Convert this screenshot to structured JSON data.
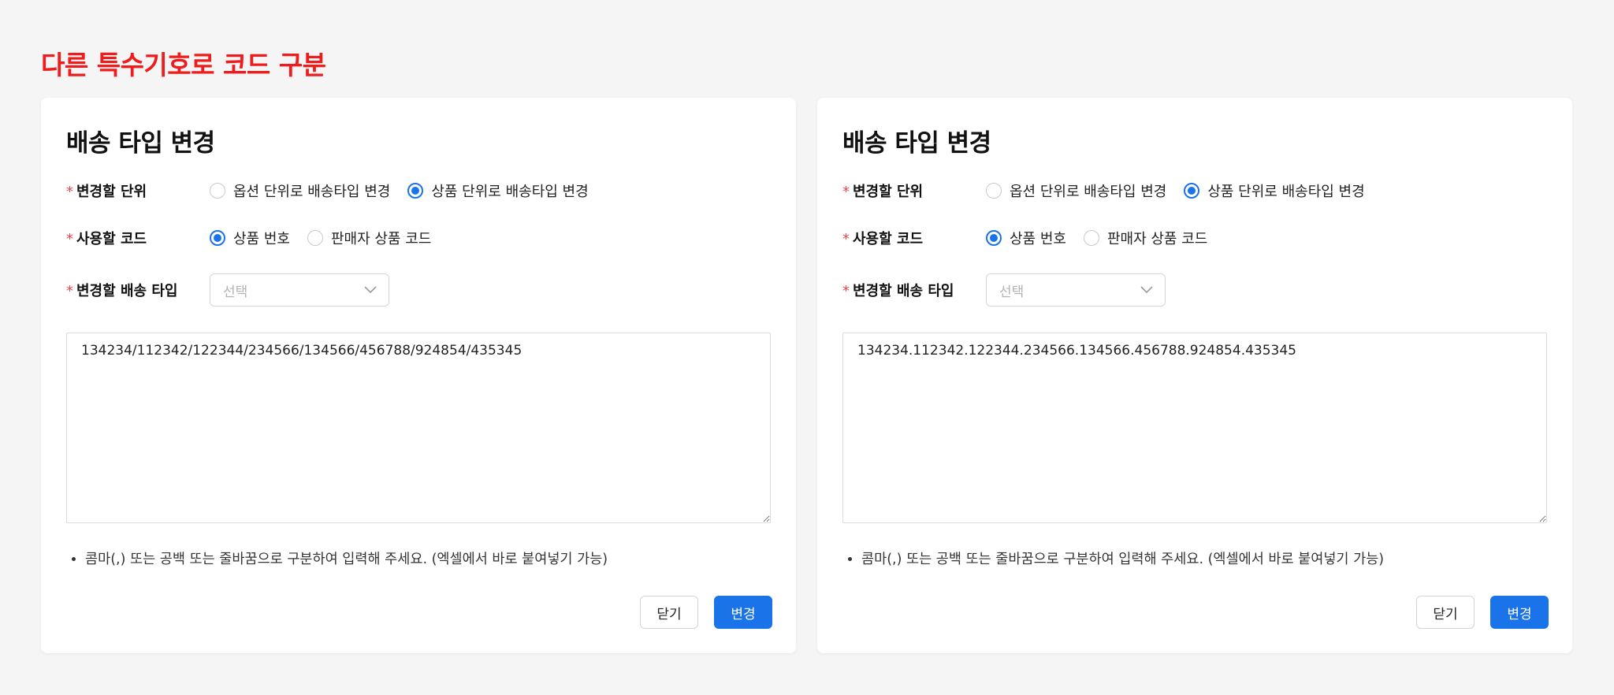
{
  "page": {
    "heading": "다른 특수기호로 코드 구분",
    "heading_color": "#ee1c1c",
    "accent_color": "#1a73e8"
  },
  "modals": [
    {
      "title": "배송 타입 변경",
      "required_mark": "*",
      "unit_label": "변경할 단위",
      "unit_options": [
        {
          "label": "옵션 단위로 배송타입 변경",
          "checked": false
        },
        {
          "label": "상품 단위로 배송타입 변경",
          "checked": true
        }
      ],
      "code_label": "사용할 코드",
      "code_options": [
        {
          "label": "상품 번호",
          "checked": true
        },
        {
          "label": "판매자 상품 코드",
          "checked": false
        }
      ],
      "type_label": "변경할 배송 타입",
      "type_select_placeholder": "선택",
      "chevron_icon": "chevron-down-icon",
      "codes_value": "134234/112342/122344/234566/134566/456788/924854/435345",
      "help_text": "콤마(,) 또는 공백 또는 줄바꿈으로 구분하여 입력해 주세요. (엑셀에서 바로 붙여넣기 가능)",
      "close_label": "닫기",
      "submit_label": "변경"
    },
    {
      "title": "배송 타입 변경",
      "required_mark": "*",
      "unit_label": "변경할 단위",
      "unit_options": [
        {
          "label": "옵션 단위로 배송타입 변경",
          "checked": false
        },
        {
          "label": "상품 단위로 배송타입 변경",
          "checked": true
        }
      ],
      "code_label": "사용할 코드",
      "code_options": [
        {
          "label": "상품 번호",
          "checked": true
        },
        {
          "label": "판매자 상품 코드",
          "checked": false
        }
      ],
      "type_label": "변경할 배송 타입",
      "type_select_placeholder": "선택",
      "chevron_icon": "chevron-down-icon",
      "codes_value": "134234.112342.122344.234566.134566.456788.924854.435345",
      "help_text": "콤마(,) 또는 공백 또는 줄바꿈으로 구분하여 입력해 주세요. (엑셀에서 바로 붙여넣기 가능)",
      "close_label": "닫기",
      "submit_label": "변경"
    }
  ]
}
